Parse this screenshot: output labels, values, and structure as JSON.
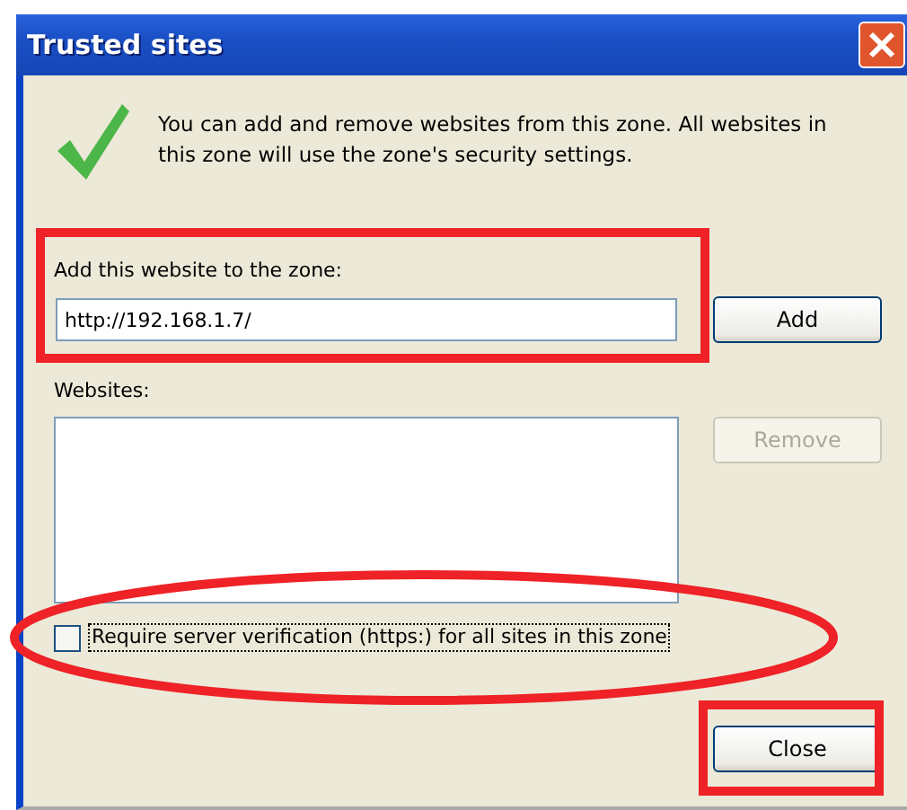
{
  "window": {
    "title": "Trusted sites"
  },
  "intro": "You can add and remove websites from this zone. All websites in this zone will use the zone's security settings.",
  "add_field": {
    "label": "Add this website to the zone:",
    "value": "http://192.168.1.7/"
  },
  "add_button": {
    "label": "Add",
    "disabled": false
  },
  "websites": {
    "label": "Websites:"
  },
  "remove_button": {
    "label": "Remove",
    "disabled": true
  },
  "require_https": {
    "label": "Require server verification (https:) for all sites in this zone",
    "checked": false
  },
  "close_button": {
    "label": "Close",
    "disabled": false
  }
}
